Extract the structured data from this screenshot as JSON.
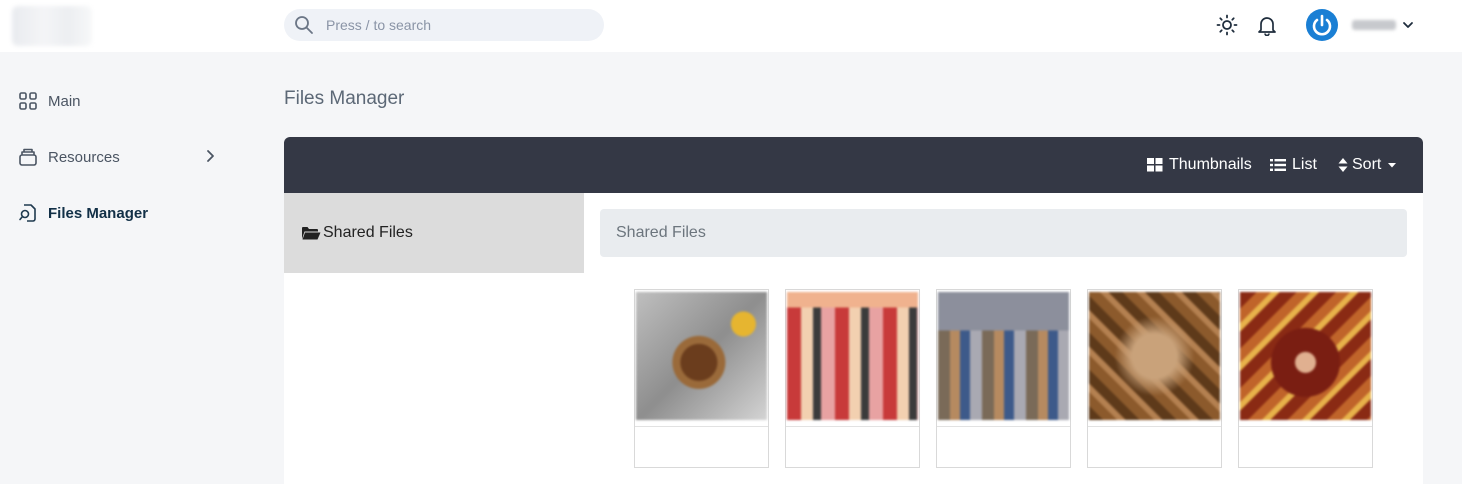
{
  "search": {
    "placeholder": "Press / to search"
  },
  "header": {
    "theme_icon": "sun-icon",
    "notification_icon": "bell-icon",
    "avatar_icon": "power-icon",
    "user_name": ""
  },
  "sidebar": {
    "items": [
      {
        "label": "Main",
        "icon": "grid-icon",
        "active": false
      },
      {
        "label": "Resources",
        "icon": "layers-icon",
        "active": false,
        "has_submenu": true
      },
      {
        "label": "Files Manager",
        "icon": "file-search-icon",
        "active": true
      }
    ]
  },
  "page": {
    "title": "Files Manager"
  },
  "toolbar": {
    "thumbnails_label": "Thumbnails",
    "list_label": "List",
    "sort_label": "Sort"
  },
  "tree": {
    "items": [
      {
        "label": "Shared Files",
        "icon": "folder-open-icon",
        "selected": true
      }
    ]
  },
  "breadcrumb": {
    "label": "Shared Files"
  },
  "files": [
    {
      "name": ""
    },
    {
      "name": ""
    },
    {
      "name": ""
    },
    {
      "name": ""
    },
    {
      "name": ""
    }
  ],
  "colors": {
    "toolbar_bg": "#343845",
    "accent": "#1a7fd4",
    "active_nav_text": "#123047",
    "tree_selected_bg": "#dcdcdc"
  }
}
